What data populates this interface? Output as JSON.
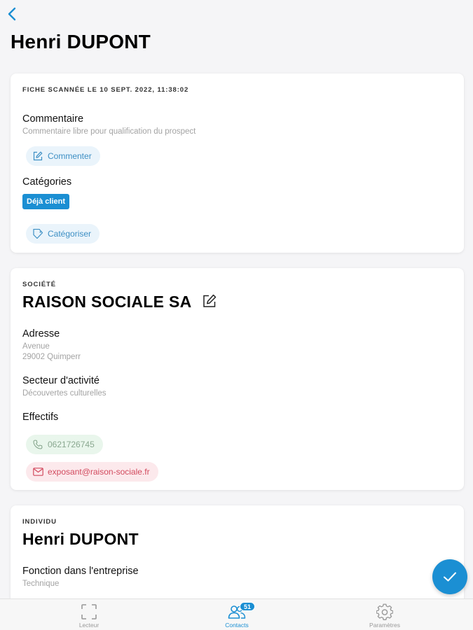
{
  "header": {
    "title": "Henri DUPONT"
  },
  "scan_card": {
    "scanned_label": "FICHE SCANNÉE LE 10 SEPT. 2022, 11:38:02",
    "comment_title": "Commentaire",
    "comment_subtitle": "Commentaire libre pour qualification du prospect",
    "comment_button": "Commenter",
    "categories_title": "Catégories",
    "category_tag": "Déjà client",
    "categorize_button": "Catégoriser"
  },
  "company_card": {
    "overline": "SOCIÉTÉ",
    "name": "RAISON SOCIALE SA",
    "address_title": "Adresse",
    "address_line1": "Avenue",
    "address_line2": "29002 Quimperr",
    "sector_title": "Secteur d'activité",
    "sector_value": "Découvertes culturelles",
    "staff_title": "Effectifs",
    "phone": "0621726745",
    "email": "exposant@raison-sociale.fr"
  },
  "person_card": {
    "overline": "INDIVIDU",
    "name": "Henri DUPONT",
    "role_title": "Fonction dans l'entreprise",
    "role_value": "Technique"
  },
  "tabbar": {
    "tabs": [
      {
        "label": "Lecteur",
        "icon": "scan-frame-icon"
      },
      {
        "label": "Contacts",
        "icon": "contacts-icon",
        "badge": "51"
      },
      {
        "label": "Paramètres",
        "icon": "gear-icon"
      }
    ]
  },
  "colors": {
    "accent": "#1b8fd3",
    "phone_chip": "#e9f6ec",
    "email_chip": "#fce9ec",
    "blue_chip": "#eaf4fb"
  }
}
